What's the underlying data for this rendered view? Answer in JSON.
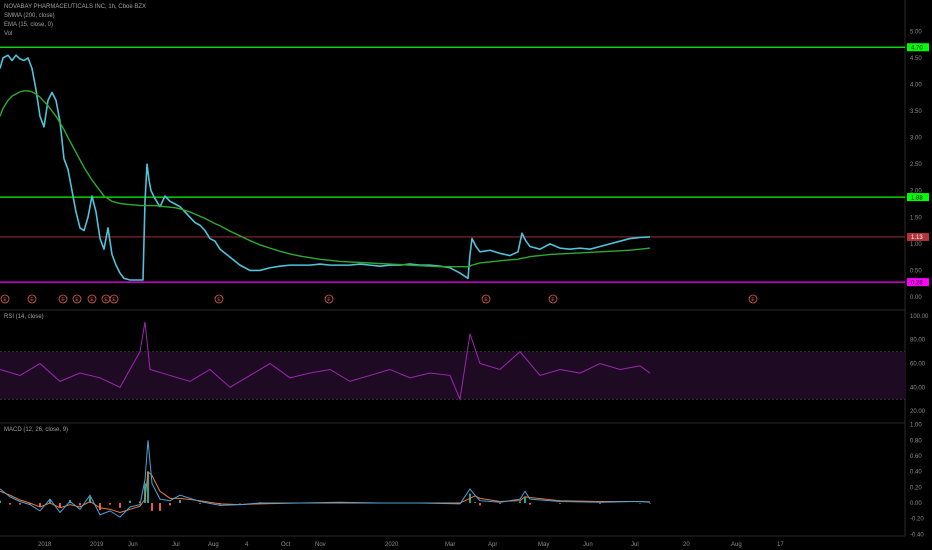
{
  "header": {
    "symbol_line": "NOVABAY PHARMACEUTICALS INC, 1h, Cboe BZX",
    "smma_label": "SMMA (200, close)",
    "ema_label": "EMA (15, close, 0)",
    "vol_label": "Vol"
  },
  "colors": {
    "background": "#000000",
    "price": "#4fc3d9",
    "smma": "#2eaa2e",
    "level_green": "#00ff00",
    "level_magenta": "#ff00ff",
    "current_price": "#b2353a",
    "rsi": "#9c27b0",
    "rsi_band": "#1f0a24",
    "macd": "#4fa3d9",
    "signal": "#e67e3c",
    "hist_pos": "#26a69a",
    "hist_neg": "#ef5350",
    "event": "#e06050"
  },
  "chart_data": [
    {
      "type": "line",
      "panel": "price",
      "title": "NOVABAY PHARMACEUTICALS INC, 1h, Cboe BZX",
      "ylim": [
        0,
        5.25
      ],
      "yticks": [
        "5.00",
        "4.50",
        "4.00",
        "3.50",
        "3.00",
        "2.50",
        "2.00",
        "1.50",
        "1.00",
        "0.50",
        "0.00"
      ],
      "x_labels": [
        "2018",
        "2019",
        "Jun",
        "Jul",
        "Aug",
        "4",
        "Oct",
        "Nov",
        "2020",
        "Mar",
        "Apr",
        "May",
        "Jun",
        "Jul",
        "20",
        "Aug",
        "17"
      ],
      "x": [
        0,
        3,
        8,
        12,
        16,
        20,
        24,
        28,
        32,
        36,
        40,
        44,
        48,
        52,
        56,
        60,
        64,
        68,
        72,
        76,
        80,
        84,
        88,
        92,
        96,
        100,
        104,
        108,
        112,
        116,
        120,
        124,
        130,
        136,
        140,
        143,
        145,
        147,
        149,
        151,
        155,
        160,
        165,
        170,
        175,
        180,
        185,
        190,
        195,
        200,
        205,
        210,
        215,
        220,
        230,
        240,
        250,
        260,
        270,
        280,
        290,
        300,
        310,
        320,
        330,
        340,
        350,
        360,
        370,
        380,
        390,
        400,
        410,
        420,
        430,
        440,
        450,
        460,
        468,
        470,
        472,
        476,
        480,
        490,
        500,
        510,
        518,
        522,
        526,
        530,
        540,
        550,
        560,
        570,
        580,
        590,
        600,
        610,
        620,
        630,
        640,
        650
      ],
      "series": [
        {
          "name": "EMA (15, close, 0)",
          "values": [
            4.3,
            4.5,
            4.55,
            4.45,
            4.55,
            4.48,
            4.45,
            4.5,
            4.3,
            3.9,
            3.4,
            3.2,
            3.7,
            3.85,
            3.7,
            3.3,
            2.6,
            2.4,
            2.0,
            1.6,
            1.3,
            1.25,
            1.5,
            1.9,
            1.6,
            1.1,
            0.9,
            1.3,
            0.8,
            0.6,
            0.45,
            0.35,
            0.32,
            0.32,
            0.32,
            0.32,
            1.8,
            2.5,
            2.2,
            2.0,
            1.85,
            1.7,
            1.9,
            1.8,
            1.75,
            1.7,
            1.6,
            1.5,
            1.4,
            1.35,
            1.25,
            1.1,
            1.05,
            0.9,
            0.75,
            0.6,
            0.5,
            0.5,
            0.55,
            0.58,
            0.6,
            0.6,
            0.6,
            0.62,
            0.6,
            0.6,
            0.6,
            0.62,
            0.6,
            0.58,
            0.6,
            0.6,
            0.62,
            0.6,
            0.6,
            0.58,
            0.55,
            0.45,
            0.35,
            0.8,
            1.1,
            0.95,
            0.85,
            0.88,
            0.82,
            0.78,
            0.85,
            1.2,
            1.05,
            0.95,
            0.9,
            1.0,
            0.92,
            0.9,
            0.92,
            0.9,
            0.95,
            1.0,
            1.05,
            1.1,
            1.12,
            1.13
          ]
        },
        {
          "name": "SMMA (200, close)",
          "values": [
            3.4,
            3.55,
            3.7,
            3.78,
            3.82,
            3.86,
            3.88,
            3.88,
            3.86,
            3.82,
            3.76,
            3.68,
            3.6,
            3.5,
            3.4,
            3.28,
            3.15,
            3.0,
            2.86,
            2.72,
            2.58,
            2.44,
            2.32,
            2.2,
            2.1,
            2.0,
            1.9,
            1.85,
            1.8,
            1.78,
            1.76,
            1.75,
            1.74,
            1.73,
            1.72,
            1.72,
            1.72,
            1.72,
            1.72,
            1.72,
            1.72,
            1.71,
            1.7,
            1.69,
            1.68,
            1.66,
            1.63,
            1.6,
            1.56,
            1.52,
            1.48,
            1.43,
            1.38,
            1.34,
            1.24,
            1.15,
            1.06,
            0.98,
            0.92,
            0.86,
            0.81,
            0.77,
            0.74,
            0.71,
            0.69,
            0.67,
            0.66,
            0.65,
            0.64,
            0.63,
            0.62,
            0.61,
            0.6,
            0.59,
            0.58,
            0.57,
            0.57,
            0.57,
            0.57,
            0.58,
            0.6,
            0.62,
            0.64,
            0.66,
            0.68,
            0.7,
            0.71,
            0.73,
            0.74,
            0.76,
            0.78,
            0.8,
            0.81,
            0.82,
            0.83,
            0.84,
            0.85,
            0.86,
            0.87,
            0.88,
            0.9,
            0.92
          ]
        }
      ],
      "levels": [
        {
          "value": 4.7,
          "label": "4.70",
          "color": "#00ff00"
        },
        {
          "value": 1.88,
          "label": "1.88",
          "color": "#00ff00"
        },
        {
          "value": 1.13,
          "label": "1.13",
          "color": "#b2353a"
        },
        {
          "value": 0.28,
          "label": "0.28",
          "color": "#ff00ff"
        }
      ],
      "events": {
        "label": "E",
        "x": [
          5,
          32,
          63,
          77,
          92,
          106,
          114,
          219,
          329,
          486,
          553,
          753
        ]
      }
    },
    {
      "type": "line",
      "panel": "rsi",
      "title": "RSI (14, close)",
      "ylim": [
        10,
        105
      ],
      "yticks": [
        "100.00",
        "80.00",
        "60.00",
        "40.00",
        "20.00"
      ],
      "band": [
        30,
        70
      ],
      "x": [
        0,
        20,
        40,
        60,
        80,
        100,
        120,
        140,
        145,
        150,
        170,
        190,
        210,
        230,
        250,
        270,
        290,
        310,
        330,
        350,
        370,
        390,
        410,
        430,
        450,
        460,
        470,
        480,
        500,
        520,
        540,
        560,
        580,
        600,
        620,
        640,
        650
      ],
      "series": [
        {
          "name": "RSI",
          "values": [
            55,
            50,
            60,
            45,
            52,
            48,
            40,
            70,
            95,
            55,
            50,
            45,
            55,
            40,
            50,
            60,
            48,
            52,
            55,
            45,
            50,
            55,
            48,
            52,
            50,
            30,
            85,
            60,
            55,
            70,
            50,
            55,
            52,
            60,
            55,
            58,
            52
          ]
        }
      ]
    },
    {
      "type": "line",
      "panel": "macd",
      "title": "MACD (12, 26, close, 9)",
      "ylim": [
        -0.42,
        1.02
      ],
      "yticks": [
        "1.00",
        "0.80",
        "0.60",
        "0.40",
        "0.20",
        "0.00",
        "-0.20",
        "-0.40"
      ],
      "x": [
        0,
        10,
        20,
        30,
        40,
        50,
        60,
        70,
        80,
        90,
        100,
        110,
        120,
        130,
        140,
        145,
        148,
        152,
        160,
        170,
        180,
        200,
        220,
        240,
        260,
        300,
        340,
        380,
        420,
        460,
        470,
        475,
        480,
        500,
        520,
        525,
        530,
        560,
        600,
        640,
        650
      ],
      "series": [
        {
          "name": "MACD",
          "values": [
            0.18,
            0.08,
            0.02,
            -0.02,
            -0.1,
            0.05,
            -0.12,
            0.02,
            -0.08,
            0.1,
            -0.15,
            -0.1,
            -0.18,
            -0.05,
            -0.02,
            0.3,
            0.8,
            0.25,
            0.05,
            0.03,
            0.1,
            0.02,
            -0.03,
            -0.02,
            0.0,
            0.0,
            0.01,
            0.0,
            0.0,
            -0.01,
            0.18,
            0.1,
            0.03,
            0.01,
            0.05,
            0.15,
            0.05,
            0.02,
            0.01,
            0.02,
            0.01
          ]
        },
        {
          "name": "Signal",
          "values": [
            0.15,
            0.1,
            0.04,
            0.0,
            -0.05,
            0.0,
            -0.06,
            -0.02,
            -0.05,
            0.02,
            -0.06,
            -0.08,
            -0.12,
            -0.08,
            -0.04,
            0.05,
            0.4,
            0.35,
            0.15,
            0.06,
            0.06,
            0.03,
            -0.01,
            -0.02,
            -0.01,
            0.0,
            0.0,
            0.0,
            0.0,
            0.0,
            0.06,
            0.09,
            0.06,
            0.02,
            0.03,
            0.08,
            0.07,
            0.03,
            0.02,
            0.02,
            0.015
          ]
        }
      ]
    }
  ]
}
